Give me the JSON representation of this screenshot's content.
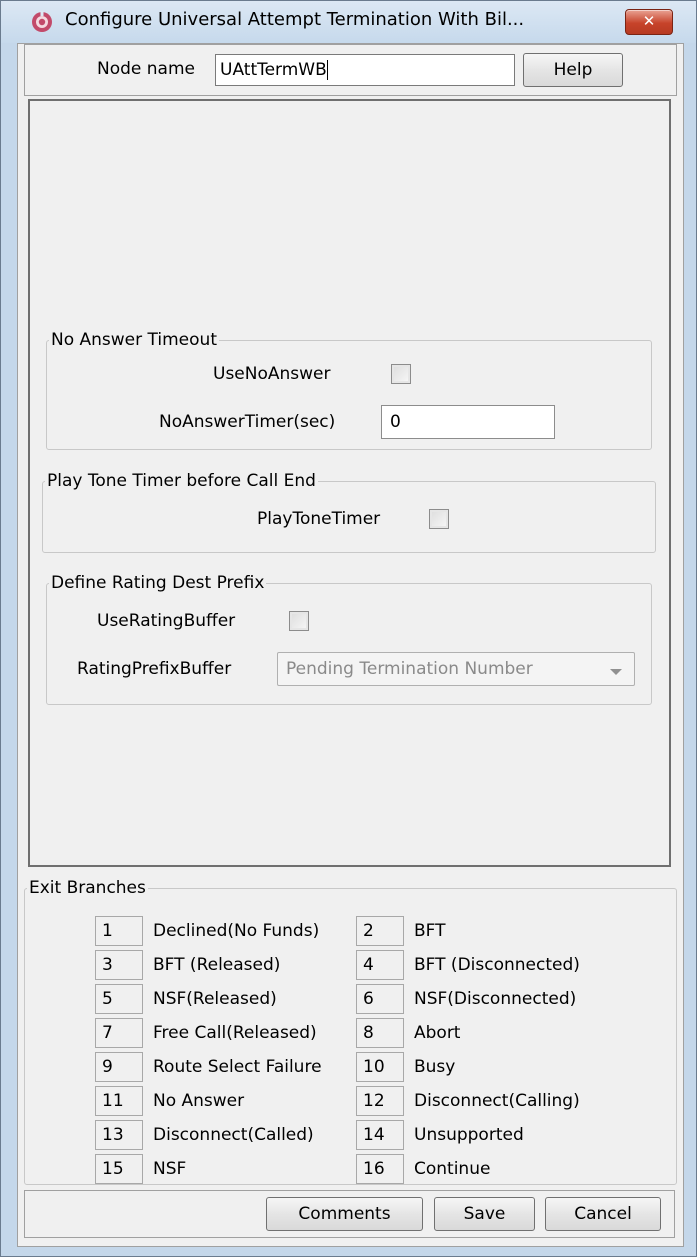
{
  "window": {
    "title": "Configure Universal Attempt Termination With Bil...",
    "close_label": "✕"
  },
  "node": {
    "label": "Node name",
    "value": "UAttTermWB",
    "help_label": "Help"
  },
  "no_answer": {
    "legend": "No Answer Timeout",
    "use_label": "UseNoAnswer",
    "timer_label": "NoAnswerTimer(sec)",
    "timer_value": "0"
  },
  "play_tone": {
    "legend": "Play Tone Timer before Call End",
    "label": "PlayToneTimer"
  },
  "rating": {
    "legend": "Define Rating Dest Prefix",
    "use_label": "UseRatingBuffer",
    "buffer_label": "RatingPrefixBuffer",
    "buffer_value": "Pending Termination Number"
  },
  "exits": {
    "legend": "Exit Branches",
    "rows": [
      {
        "n1": "1",
        "d1": "Declined(No Funds)",
        "n2": "2",
        "d2": "BFT"
      },
      {
        "n1": "3",
        "d1": "BFT (Released)",
        "n2": "4",
        "d2": "BFT (Disconnected)"
      },
      {
        "n1": "5",
        "d1": "NSF(Released)",
        "n2": "6",
        "d2": "NSF(Disconnected)"
      },
      {
        "n1": "7",
        "d1": "Free Call(Released)",
        "n2": "8",
        "d2": "Abort"
      },
      {
        "n1": "9",
        "d1": "Route Select Failure",
        "n2": "10",
        "d2": "Busy"
      },
      {
        "n1": "11",
        "d1": "No Answer",
        "n2": "12",
        "d2": "Disconnect(Calling)"
      },
      {
        "n1": "13",
        "d1": "Disconnect(Called)",
        "n2": "14",
        "d2": "Unsupported"
      },
      {
        "n1": "15",
        "d1": "NSF",
        "n2": "16",
        "d2": "Continue"
      }
    ]
  },
  "footer": {
    "comments_label": "Comments",
    "save_label": "Save",
    "cancel_label": "Cancel"
  }
}
